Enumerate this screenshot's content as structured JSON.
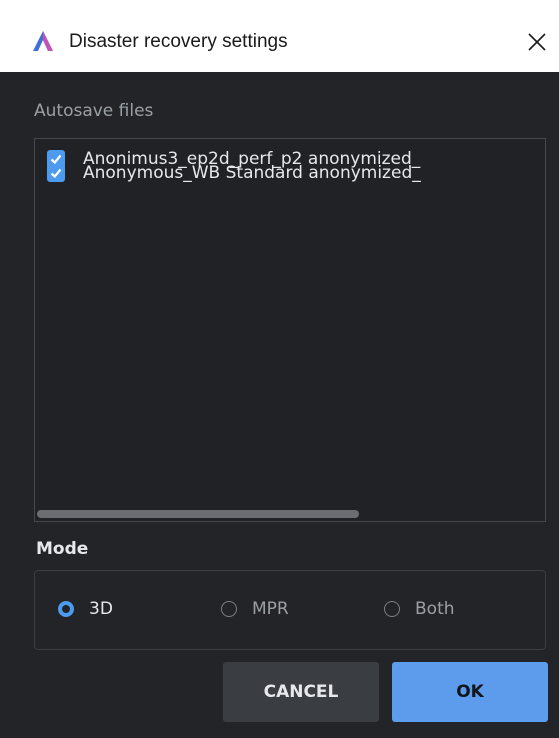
{
  "window": {
    "title": "Disaster recovery settings",
    "close_glyph": "✕",
    "app_icon": "app-logo-icon"
  },
  "autosave": {
    "label": "Autosave files",
    "files": [
      {
        "name": "Anonimus3_ep2d_perf_p2 anonymized_",
        "checked": true
      },
      {
        "name": "Anonymous_WB Standard anonymized_",
        "checked": true
      }
    ]
  },
  "mode": {
    "label": "Mode",
    "options": [
      {
        "label": "3D",
        "selected": true
      },
      {
        "label": "MPR",
        "selected": false
      },
      {
        "label": "Both",
        "selected": false
      }
    ]
  },
  "buttons": {
    "cancel": "CANCEL",
    "ok": "OK"
  },
  "colors": {
    "accent": "#4d9bef",
    "background": "#222427",
    "ok_button": "#5d9cec"
  }
}
